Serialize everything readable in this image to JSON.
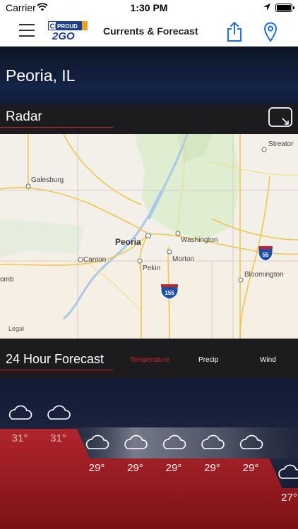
{
  "status_bar": {
    "carrier": "Carrier",
    "time": "1:30 PM"
  },
  "nav": {
    "title": "Currents & Forecast",
    "logo_line1": "CIPROUD",
    "logo_line2": "2GO"
  },
  "city": {
    "name": "Peoria, IL"
  },
  "radar": {
    "title": "Radar",
    "legal": "Legal",
    "places": [
      "Galesburg",
      "Streator",
      "Peoria",
      "Washington",
      "Canton",
      "Morton",
      "Pekin",
      "Bloomington",
      "omb"
    ],
    "shields": [
      "55",
      "155"
    ]
  },
  "forecast": {
    "title": "24 Hour Forecast",
    "tabs": [
      "Temperature",
      "Precip",
      "Wind"
    ],
    "active_tab": "Temperature",
    "hours": [
      {
        "temp": "31°",
        "icon": "cloud-icon"
      },
      {
        "temp": "31°",
        "icon": "cloud-icon"
      },
      {
        "temp": "29°",
        "icon": "cloud-icon"
      },
      {
        "temp": "29°",
        "icon": "cloud-icon"
      },
      {
        "temp": "29°",
        "icon": "cloud-icon"
      },
      {
        "temp": "29°",
        "icon": "cloud-icon"
      },
      {
        "temp": "29°",
        "icon": "cloud-icon"
      },
      {
        "temp": "27°",
        "icon": "cloud-icon"
      }
    ]
  },
  "colors": {
    "accent": "#c8232b",
    "brand_blue": "#1e6fd9",
    "header_bg": "#1c1c1e"
  }
}
